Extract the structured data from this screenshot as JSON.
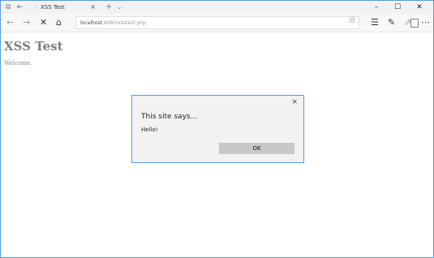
{
  "tab": {
    "title": "XSS Test",
    "close_glyph": "×"
  },
  "address": {
    "url_host": "localhost",
    "url_rest": ":8080/xsstest.php"
  },
  "page": {
    "heading": "XSS Test",
    "welcome": "Welcome,"
  },
  "dialog": {
    "close_glyph": "×",
    "title": "This site says...",
    "message": "Hello!",
    "ok_label": "OK"
  },
  "icons": {
    "tab-preview": "tab-preview-icon",
    "set-aside": "set-aside-tabs-icon",
    "new-tab": "+",
    "tab-list": "chevron-down-icon",
    "minimize": "–",
    "maximize": "☐",
    "close": "✕",
    "back": "←",
    "forward": "→",
    "stop": "✕",
    "home": "⌂",
    "favorites-star": "☆",
    "hub": "hub-icon",
    "notes": "pen-icon",
    "share": "share-icon",
    "more": "⋯"
  },
  "colors": {
    "dialog_border": "#5b9bd5",
    "window_border": "#5a9bd5"
  }
}
